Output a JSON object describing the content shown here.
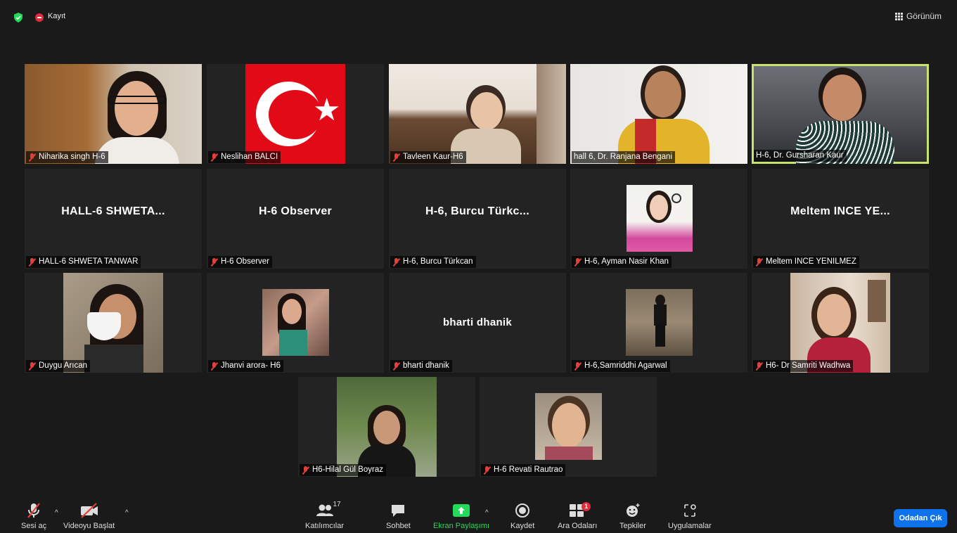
{
  "topbar": {
    "recording_label": "Kayıt",
    "view_label": "Görünüm"
  },
  "tiles": {
    "niharika": {
      "name": "Niharika singh H-6"
    },
    "neslihan": {
      "name": "Neslihan BALCI"
    },
    "tavleen": {
      "name": "Tavleen Kaur-H6"
    },
    "ranjana": {
      "name": "hall 6,  Dr. Ranjana Bengani"
    },
    "gursharan": {
      "name": "H-6, Dr. Gursharan Kaur"
    },
    "shweta": {
      "display": "HALL-6  SHWETA...",
      "name": "HALL-6 SHWETA TANWAR"
    },
    "observer": {
      "display": "H-6 Observer",
      "name": "H-6 Observer"
    },
    "burcu": {
      "display": "H-6, Burcu Türkc...",
      "name": "H-6, Burcu Türkcan"
    },
    "ayman": {
      "name": "H-6, Ayman Nasir Khan"
    },
    "meltem": {
      "display": "Meltem INCE YE...",
      "name": "Meltem INCE YENILMEZ"
    },
    "duygu": {
      "name": "Duygu Arıcan"
    },
    "jhanvi": {
      "name": "Jhanvi arora- H6"
    },
    "bharti": {
      "display": "bharti dhanik",
      "name": "bharti dhanik"
    },
    "samriddhi": {
      "name": "H-6,Samriddhi Agarwal"
    },
    "samriti": {
      "name": "H6- Dr Samriti Wadhwa"
    },
    "hilal": {
      "name": "H6-Hilal Gül Boyraz"
    },
    "revati": {
      "name": "H-6 Revati Rautrao"
    }
  },
  "toolbar": {
    "unmute": "Sesi aç",
    "start_video": "Videoyu Başlat",
    "participants": "Katılımcılar",
    "participants_count": "17",
    "chat": "Sohbet",
    "share": "Ekran Paylaşımı",
    "record": "Kaydet",
    "breakout": "Ara Odaları",
    "breakout_badge": "1",
    "reactions": "Tepkiler",
    "apps": "Uygulamalar",
    "leave": "Odadan Çık"
  },
  "colors": {
    "background": "#1a1a1a",
    "tile": "#232323",
    "active_speaker_border": "#c8e36c",
    "share_green": "#23d959",
    "leave_blue": "#0e72ed",
    "muted_red": "#e0403c"
  }
}
